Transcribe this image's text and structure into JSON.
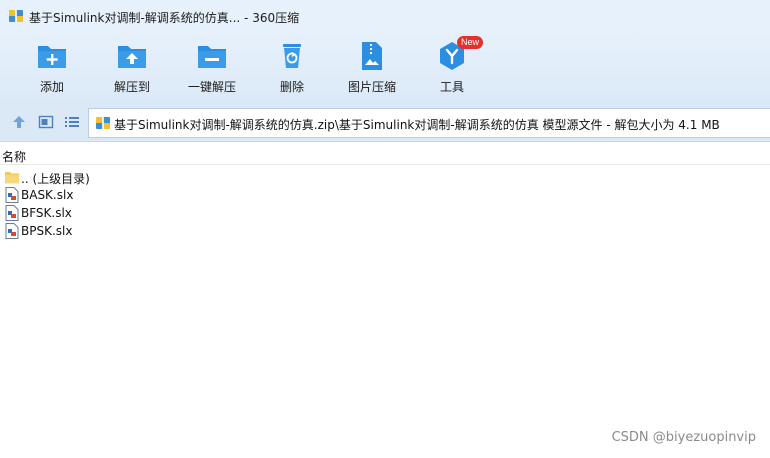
{
  "window": {
    "title": "基于Simulink对调制-解调系统的仿真... - 360压缩"
  },
  "toolbar": {
    "items": [
      {
        "label": "添加",
        "icon": "add-folder-icon"
      },
      {
        "label": "解压到",
        "icon": "extract-to-icon"
      },
      {
        "label": "一键解压",
        "icon": "one-click-extract-icon"
      },
      {
        "label": "删除",
        "icon": "recycle-bin-icon"
      },
      {
        "label": "图片压缩",
        "icon": "image-compress-icon"
      },
      {
        "label": "工具",
        "icon": "tools-icon",
        "badge": "New"
      }
    ]
  },
  "nav": {
    "buttons": [
      {
        "icon": "up-arrow-icon"
      },
      {
        "icon": "preview-pane-icon"
      },
      {
        "icon": "list-view-icon"
      }
    ]
  },
  "address": {
    "path": "基于Simulink对调制-解调系统的仿真.zip\\基于Simulink对调制-解调系统的仿真 模型源文件 - 解包大小为 4.1 MB"
  },
  "list": {
    "column_name": "名称",
    "items": [
      {
        "name": ".. (上级目录)",
        "icon": "folder-icon"
      },
      {
        "name": "BASK.slx",
        "icon": "file-icon"
      },
      {
        "name": "BFSK.slx",
        "icon": "file-icon"
      },
      {
        "name": "BPSK.slx",
        "icon": "file-icon"
      }
    ]
  },
  "watermark": "CSDN @biyezuopinvip",
  "colors": {
    "toolbar_blue": "#2c8ee0",
    "badge_red": "#e5302b",
    "chrome_bg": "#e7f1fb"
  }
}
